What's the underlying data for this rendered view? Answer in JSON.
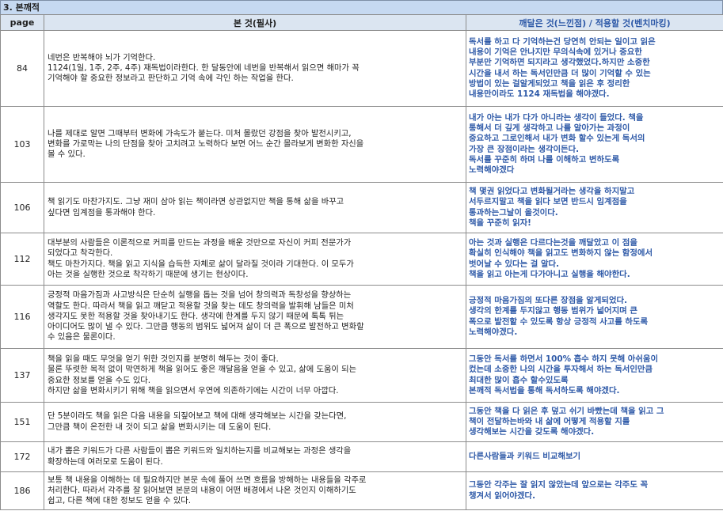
{
  "section_title": "3. 본깨적",
  "headers": {
    "page": "page",
    "quote": "본 것(필사)",
    "note": "깨달은 것(느낀점) / 적용할 것(벤치마킹)"
  },
  "rows": [
    {
      "page": "84",
      "quote": "네번은 반복해야 뇌가 기억한다.\n1124(1일, 1주, 2주, 4주) 재독법이라한다. 한 달동안에 네번을 반복해서 읽으면 해마가 꼭\n기억해야 할 중요한 정보라고 판단하고 기억 속에 각인 하는 작업을 한다.",
      "note": "독서를 하고 다 기억하는건 당연히 안되는 일이고 읽은\n내용이 기억은 안나지만 무의식속에 있거나 중요한\n부분만 기억하면 되지라고 생각했었다.하지만 소중한\n시간을 내서 하는 독서인만큼 더 많이 기억할 수 있는\n방법이 있는 걸알게되었고 책을 읽은 후 정리한\n내용만이라도 1124 재독법을 해야겠다."
    },
    {
      "page": "103",
      "quote": "나를 제대로 알면 그때부터 변화에 가속도가 붙는다. 미처 몰랐던 강점을 찾아 발전시키고,\n변화를 가로막는 나의 단점을 찾아 고치려고 노력하다 보면 어느 순간 몰라보게 변화한 자신을\n볼 수 있다.",
      "note": "내가 아는 내가 다가 아니라는 생각이 들었다. 책을\n통해서 더 깊게 생각하고 나를 알아가는 과정이\n중요하고 그로인해서 내가 변화 할수 있는게 독서의\n가장 큰 장점이라는 생각이든다.\n독서를 꾸준히 하며 나를 이해하고 변하도록\n노력해야겠다"
    },
    {
      "page": "106",
      "quote": "책 읽기도 마찬가지도. 그냥 재미 삼아 읽는 책이라면 상관없지만 책을 통해 삶을 바꾸고\n싶다면 임계점을 통과해야 한다.",
      "note": "책 몇권 읽었다고 변화될거라는 생각을 하지말고\n서두르지말고 책을 읽다 보면 반드시 임계점을\n통과하는그날이 올것이다.\n책을 꾸준히 읽자!"
    },
    {
      "page": "112",
      "quote": "대부분의 사람들은 이론적으로 커피를 만드는 과정을 배운 것만으로 자신이 커피 전문가가\n되었다고 착각한다.\n책도 마찬가지다. 책을 읽고 지식을 습득한 자체로 삶이 달라질 것이라 기대한다. 이 모두가\n아는 것을 실행한 것으로 착각하기 때문에 생기는 현상이다.",
      "note": "아는 것과 실행은 다르다는것을 깨달았고 이 점을\n확실히 인식해야 책을 읽고도 변화하지 않는 함정에서\n벗어날 수 있다는 걸 알다.\n책을 읽고 아는게 다가아니고 실행을 해야한다."
    },
    {
      "page": "116",
      "quote": "긍정적 마음가짐과 사고방식은 단순히 실행을 돕는 것을 넘어 창의력과 독창성을 향상하는\n역할도 한다. 따라서 책을 읽고 깨닫고 적용할 것을 찾는 데도 창의력을 발휘해 남들은 미처\n생각지도 못한 적용할 것을 찾아내기도 한다. 생각에 한계를 두지 않기 때문에 톡톡 튀는\n아이디어도 많이 낼 수 있다. 그만큼 행동의 범위도 넓어져 삶이 더 큰 폭으로 발전하고 변화할\n수 있음은 물론이다.",
      "note": "긍정적 마음가짐의 또다른 장점을 알게되었다.\n생각의 한계를 두지않고 행동 범위가 넓어지며 큰\n폭으로 발전할 수 있도록 항상 긍정적 사고를 하도록\n노력해야겠다."
    },
    {
      "page": "137",
      "quote": "책을 읽을 때도 무엇을 얻기 위한 것인지를 분명히 해두는 것이 좋다.\n물론 뚜렷한 목적 없이 막연하게 책을 읽어도 좋은 깨달음을 얻을 수 있고, 삶에 도움이 되는\n중요한 정보를 얻을 수도 있다.\n하지만 삶을 변화시키기 위해 책을 읽으면서 우연에 의존하기에는 시간이 너무 아깝다.",
      "note": "그동안 독서를 하면서 100% 흡수 하지 못해 아쉬움이\n컸는데 소중한 나의 시간을 투자해서 하는 독서인만큼\n최대한 많이 흡수 할수있도록\n본깨적 독서법을 통해 독서하도록 해야겠다."
    },
    {
      "page": "151",
      "quote": "단 5분이라도 책을 읽은 다음 내용을 되짚어보고 책에 대해 생각해보는 시간을 갖는다면,\n그만큼 책이 온전한 내 것이 되고 삶을 변화시키는 데 도움이 된다.",
      "note": "그동안 책을 다 읽은 후 덮고 쉬기 바빴는데 책을 읽고 그\n책이 전달하는바와 내 삶에 어떻게 적용할 지를\n생각해보는 시간을 갖도록 해야겠다."
    },
    {
      "page": "172",
      "quote": "내가 뽑은 키워드가 다른 사람들이 뽑은 키워드와 일치하는지를 비교해보는 과정은 생각을\n확장하는데 여러모로 도움이 된다.",
      "note": "다른사람들과 키워드 비교해보기"
    },
    {
      "page": "186",
      "quote": "보통 책 내용을 이해하는 데 필요하지만 본문 속에 풀어 쓰면 흐름을 방해하는 내용들을 각주로\n처리한다. 따라서 각주를 잘 읽어보면 본문의 내용이 어떤 배경에서 나온 것인지 이해하기도\n쉽고, 다른 책에 대한 정보도 얻을 수 있다.",
      "note": "그동안 각주는 잘 읽지 않았는데 앞으로는 각주도 꼭\n챙겨서 읽어야겠다."
    }
  ]
}
